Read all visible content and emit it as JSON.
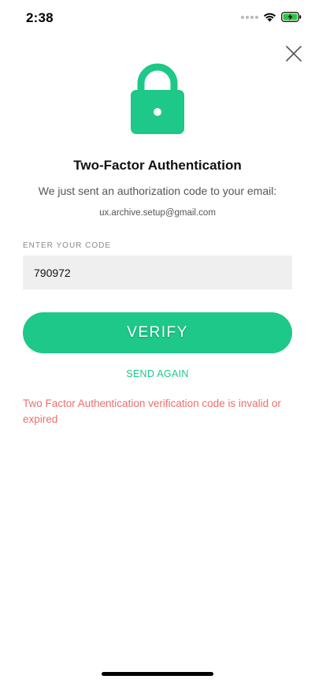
{
  "status_bar": {
    "time": "2:38"
  },
  "icons": {
    "close": "close-icon",
    "lock": "lock-icon",
    "wifi": "wifi-icon",
    "battery": "battery-charging-icon"
  },
  "colors": {
    "accent": "#1dc888",
    "error": "#ef6e6e",
    "input_bg": "#efefef"
  },
  "auth": {
    "title": "Two-Factor Authentication",
    "subtitle": "We just sent an authorization code to your email:",
    "email": "ux.archive.setup@gmail.com",
    "code_label": "ENTER YOUR CODE",
    "code_value": "790972",
    "verify_label": "VERIFY",
    "send_again_label": "SEND AGAIN",
    "error_message": "Two Factor Authentication verification code is invalid or expired"
  }
}
